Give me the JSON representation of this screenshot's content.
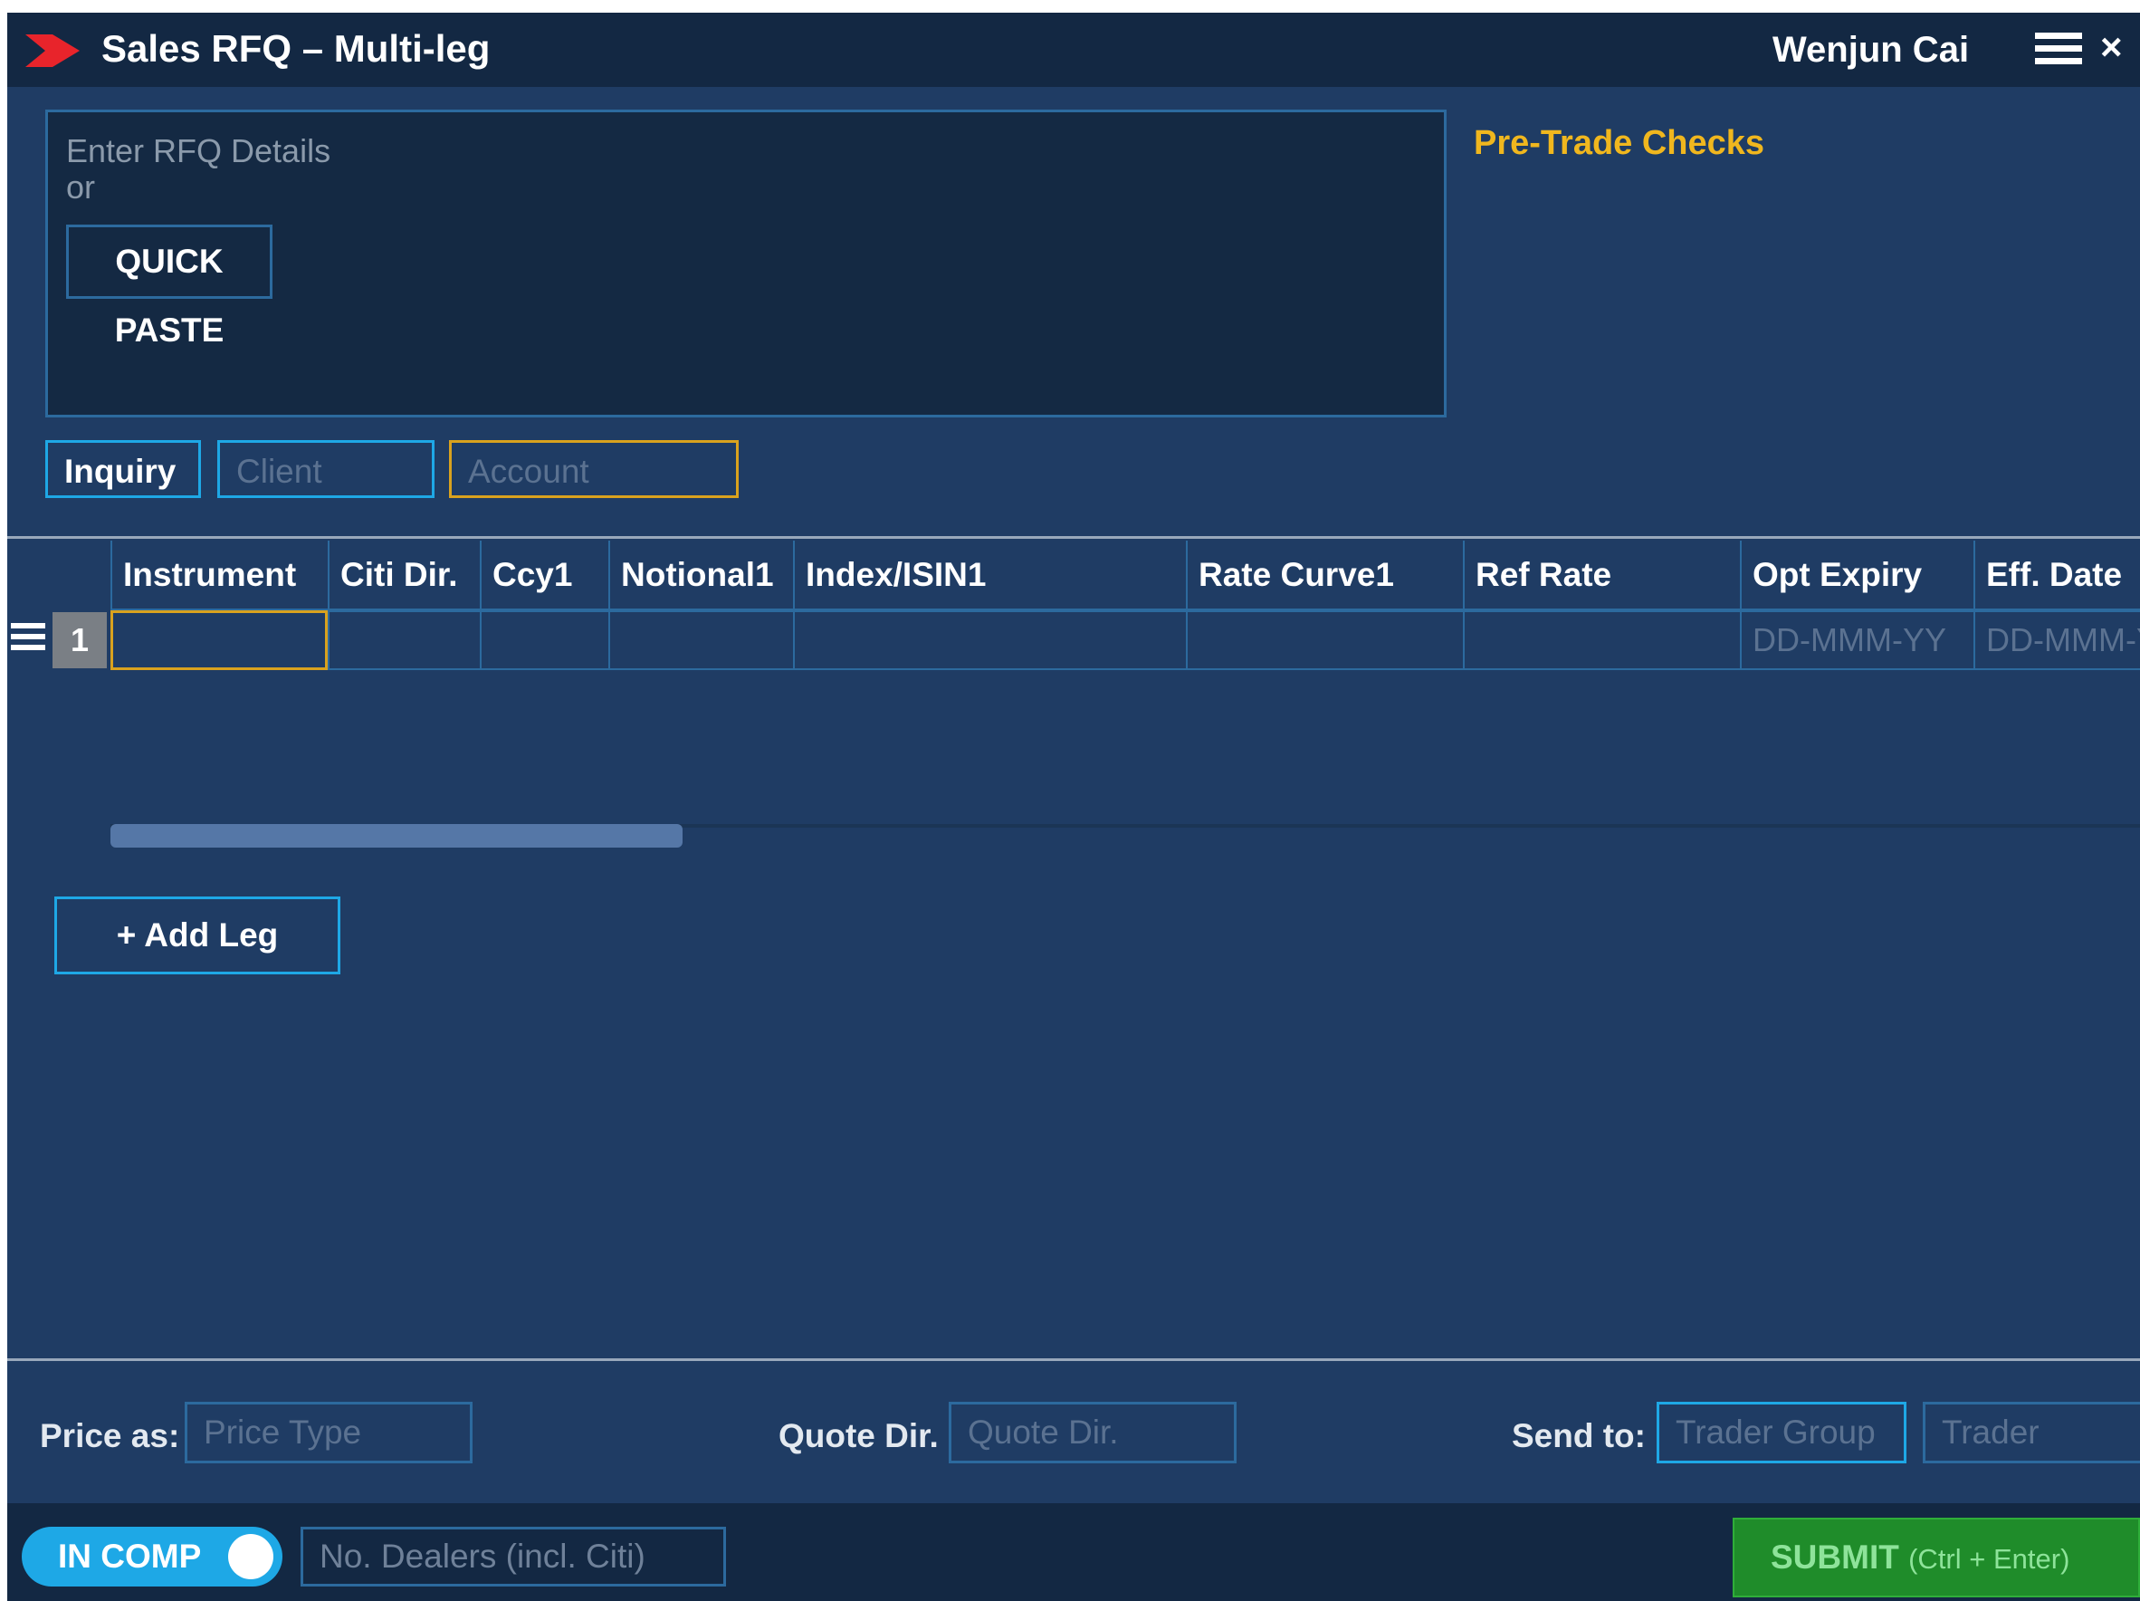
{
  "titlebar": {
    "title": "Sales RFQ – Multi-leg",
    "user": "Wenjun Cai",
    "close_glyph": "×",
    "icons": [
      "logo-chevron-icon",
      "hamburger-menu-icon",
      "close-icon"
    ]
  },
  "rfq_entry": {
    "prompt": "Enter RFQ Details",
    "or": "or",
    "quick_paste_label": "QUICK PASTE"
  },
  "pretrade": {
    "label": "Pre-Trade Checks"
  },
  "inquiry_row": {
    "inquiry_label": "Inquiry",
    "client_placeholder": "Client",
    "account_placeholder": "Account"
  },
  "legs_table": {
    "columns": [
      "Instrument",
      "Citi Dir.",
      "Ccy1",
      "Notional1",
      "Index/ISIN1",
      "Rate Curve1",
      "Ref Rate",
      "Opt Expiry",
      "Eff. Date"
    ],
    "rows": [
      {
        "num": "1",
        "cells": [
          "",
          "",
          "",
          "",
          "",
          "",
          "",
          "DD-MMM-YY",
          "DD-MMM-YY"
        ]
      }
    ]
  },
  "add_leg_label": "+ Add Leg",
  "pricing": {
    "price_as_label": "Price as:",
    "price_type_placeholder": "Price Type",
    "quote_dir_label": "Quote Dir.",
    "quote_dir_placeholder": "Quote Dir.",
    "send_to_label": "Send to:",
    "trader_group_placeholder": "Trader Group",
    "trader_placeholder": "Trader"
  },
  "footer": {
    "toggle_label": "IN COMP",
    "toggle_on": true,
    "dealers_placeholder": "No. Dealers (incl. Citi)",
    "submit_label": "SUBMIT",
    "submit_shortcut": "(Ctrl + Enter)"
  },
  "colors": {
    "background": "#1f3c64",
    "titlebar": "#132843",
    "accent_blue": "#1ea8e6",
    "accent_gold": "#f0b71e",
    "logo_red": "#e8242b",
    "submit_green": "#1f8c2a"
  }
}
